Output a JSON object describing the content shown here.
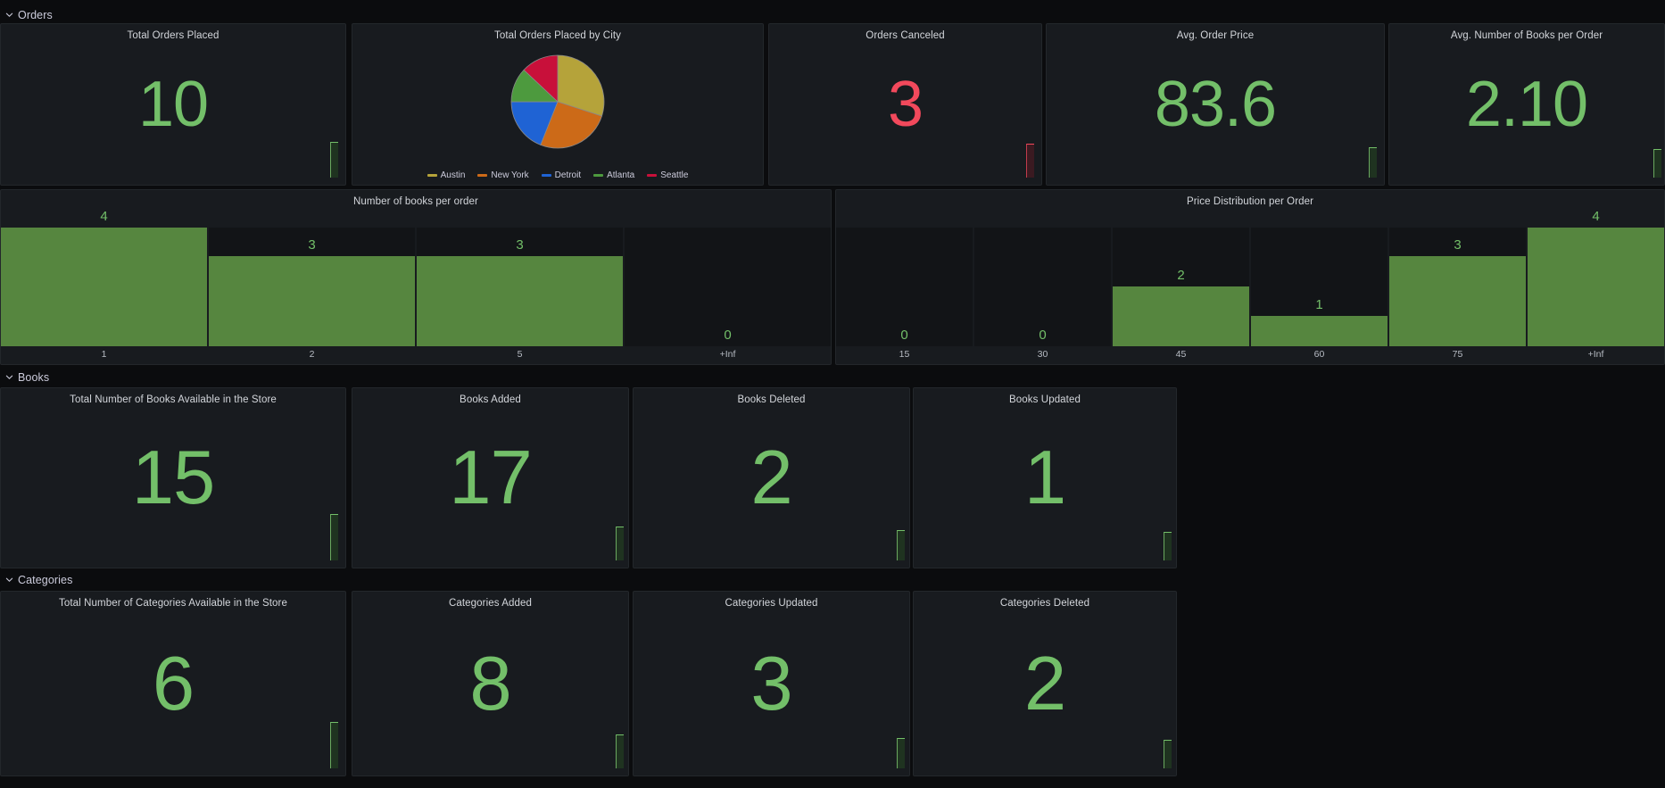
{
  "theme": {
    "page_bg": "#0b0c0e",
    "panel_bg": "#181b1f",
    "panel_border": "#23272b",
    "accent_green": "#73bf69",
    "accent_red": "#f2495c",
    "bar_green": "#56863f",
    "text": "#ccccdc"
  },
  "sections": [
    {
      "id": "orders",
      "label": "Orders",
      "icon": "chevron-down-icon"
    },
    {
      "id": "books",
      "label": "Books",
      "icon": "chevron-down-icon"
    },
    {
      "id": "categories",
      "label": "Categories",
      "icon": "chevron-down-icon"
    }
  ],
  "orders": {
    "total_orders_placed": {
      "title": "Total Orders Placed",
      "value": "10",
      "color": "#73bf69"
    },
    "orders_by_city": {
      "title": "Total Orders Placed by City"
    },
    "orders_canceled": {
      "title": "Orders Canceled",
      "value": "3",
      "color": "#f2495c"
    },
    "avg_order_price": {
      "title": "Avg. Order Price",
      "value": "83.6",
      "color": "#73bf69"
    },
    "avg_books_per_order": {
      "title": "Avg. Number of Books per Order",
      "value": "2.10",
      "color": "#73bf69"
    }
  },
  "books": {
    "total_books": {
      "title": "Total Number of Books Available in the Store",
      "value": "15"
    },
    "books_added": {
      "title": "Books Added",
      "value": "17"
    },
    "books_deleted": {
      "title": "Books Deleted",
      "value": "2"
    },
    "books_updated": {
      "title": "Books Updated",
      "value": "1"
    }
  },
  "categories": {
    "total_categories": {
      "title": "Total Number of Categories Available in the Store",
      "value": "6"
    },
    "categories_added": {
      "title": "Categories Added",
      "value": "8"
    },
    "categories_updated": {
      "title": "Categories Updated",
      "value": "3"
    },
    "categories_deleted": {
      "title": "Categories Deleted",
      "value": "2"
    }
  },
  "chart_data": [
    {
      "id": "orders-by-city-pie",
      "type": "pie",
      "title": "Total Orders Placed by City",
      "legend_position": "bottom",
      "labels": [
        "Austin",
        "New York",
        "Detroit",
        "Atlanta",
        "Seattle"
      ],
      "values": [
        30,
        26,
        19,
        12,
        13
      ],
      "colors": [
        "#b5a33a",
        "#cc6a18",
        "#1f63d4",
        "#4d9a3e",
        "#c8103a"
      ]
    },
    {
      "id": "number-of-books-per-order-hist",
      "type": "bar",
      "title": "Number of books per order",
      "xlabel": "",
      "ylabel": "",
      "grid": false,
      "categories": [
        "1",
        "2",
        "5",
        "+Inf"
      ],
      "values": [
        4,
        3,
        3,
        0
      ],
      "ylim": [
        0,
        4
      ],
      "bar_color": "#56863f",
      "label_color": "#73bf69"
    },
    {
      "id": "price-distribution-per-order-hist",
      "type": "bar",
      "title": "Price Distribution per Order",
      "xlabel": "",
      "ylabel": "",
      "grid": false,
      "categories": [
        "15",
        "30",
        "45",
        "60",
        "75",
        "+Inf"
      ],
      "values": [
        0,
        0,
        2,
        1,
        3,
        4
      ],
      "ylim": [
        0,
        4
      ],
      "bar_color": "#56863f",
      "label_color": "#73bf69"
    }
  ]
}
